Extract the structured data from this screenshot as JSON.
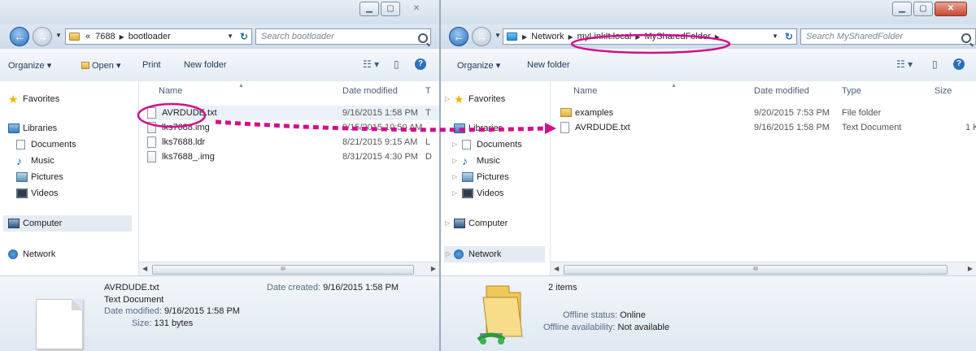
{
  "accent_color": "#d10f8b",
  "left": {
    "address": {
      "overflow": "«",
      "crumbs": [
        "7688",
        "bootloader"
      ]
    },
    "search_placeholder": "Search bootloader",
    "toolbar": {
      "organize": "Organize ▾",
      "open": "Open ▾",
      "print": "Print",
      "new_folder": "New folder"
    },
    "nav": {
      "favorites": "Favorites",
      "libraries": "Libraries",
      "documents": "Documents",
      "music": "Music",
      "pictures": "Pictures",
      "videos": "Videos",
      "computer": "Computer",
      "network": "Network"
    },
    "columns": {
      "name": "Name",
      "date": "Date modified",
      "type_trunc": "T"
    },
    "files": [
      {
        "name": "AVRDUDE.txt",
        "date": "9/16/2015 1:58 PM",
        "extra": "T"
      },
      {
        "name": "lks7688.img",
        "date": "9/15/2015 10:50 AM",
        "extra": ""
      },
      {
        "name": "lks7688.ldr",
        "date": "8/21/2015 9:15 AM",
        "extra": "L"
      },
      {
        "name": "lks7688_.img",
        "date": "8/31/2015 4:30 PM",
        "extra": "D"
      }
    ],
    "scroll_grip": "III",
    "details": {
      "name": "AVRDUDE.txt",
      "type": "Text Document",
      "modified_label": "Date modified:",
      "modified_value": "9/16/2015 1:58 PM",
      "size_label": "Size:",
      "size_value": "131 bytes",
      "created_label": "Date created:",
      "created_value": "9/16/2015 1:58 PM"
    }
  },
  "right": {
    "address": {
      "crumbs": [
        "Network",
        "myLinkIt.local",
        "MySharedFolder"
      ]
    },
    "search_placeholder": "Search MySharedFolder",
    "toolbar": {
      "organize": "Organize ▾",
      "new_folder": "New folder"
    },
    "nav": {
      "favorites": "Favorites",
      "libraries": "Libraries",
      "documents": "Documents",
      "music": "Music",
      "pictures": "Pictures",
      "videos": "Videos",
      "computer": "Computer",
      "network": "Network"
    },
    "columns": {
      "name": "Name",
      "date": "Date modified",
      "type": "Type",
      "size": "Size"
    },
    "files": [
      {
        "name": "examples",
        "date": "9/20/2015 7:53 PM",
        "type": "File folder",
        "size": ""
      },
      {
        "name": "AVRDUDE.txt",
        "date": "9/16/2015 1:58 PM",
        "type": "Text Document",
        "size": "1 K"
      }
    ],
    "scroll_grip": "III",
    "details": {
      "count": "2 items",
      "offline_status_label": "Offline status:",
      "offline_status_value": "Online",
      "offline_avail_label": "Offline availability:",
      "offline_avail_value": "Not available"
    }
  }
}
